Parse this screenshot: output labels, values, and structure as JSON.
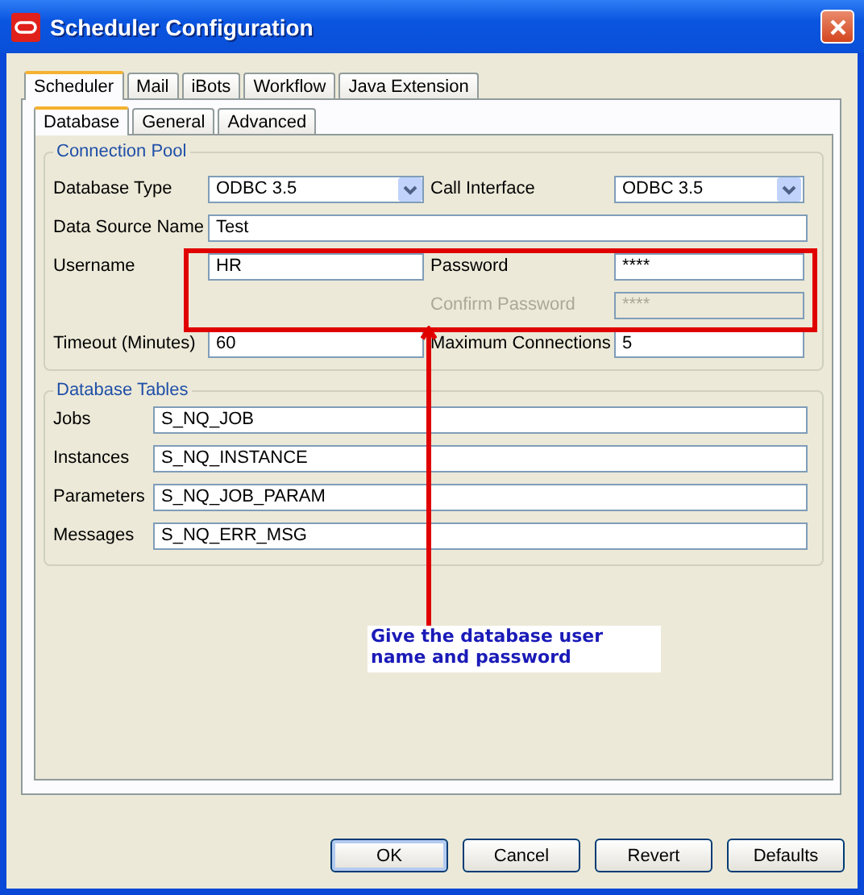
{
  "window": {
    "title": "Scheduler Configuration"
  },
  "tabs": [
    {
      "label": "Scheduler",
      "selected": true
    },
    {
      "label": "Mail",
      "selected": false
    },
    {
      "label": "iBots",
      "selected": false
    },
    {
      "label": "Workflow",
      "selected": false
    },
    {
      "label": "Java Extension",
      "selected": false
    }
  ],
  "subtabs": [
    {
      "label": "Database",
      "selected": true
    },
    {
      "label": "General",
      "selected": false
    },
    {
      "label": "Advanced",
      "selected": false
    }
  ],
  "connection_pool": {
    "title": "Connection Pool",
    "rows": [
      {
        "left": {
          "label": "Database Type",
          "value": "ODBC 3.5",
          "kind": "select",
          "disabled": false
        },
        "right": {
          "label": "Call Interface",
          "value": "ODBC 3.5",
          "kind": "select",
          "disabled": false
        }
      },
      {
        "left": {
          "label": "Data Source Name",
          "value": "Test",
          "kind": "text",
          "disabled": false
        }
      },
      {
        "left": {
          "label": "Username",
          "value": "HR",
          "kind": "text",
          "disabled": false
        },
        "right": {
          "label": "Password",
          "value": "****",
          "kind": "text",
          "disabled": false
        }
      },
      {
        "right": {
          "label": "Confirm Password",
          "value": "****",
          "kind": "text",
          "disabled": true
        }
      },
      {
        "left": {
          "label": "Timeout (Minutes)",
          "value": "60",
          "kind": "text",
          "disabled": false
        },
        "right": {
          "label": "Maximum Connections",
          "value": "5",
          "kind": "text",
          "disabled": false
        }
      }
    ]
  },
  "database_tables": {
    "title": "Database Tables",
    "fields": [
      {
        "label": "Jobs",
        "value": "S_NQ_JOB"
      },
      {
        "label": "Instances",
        "value": "S_NQ_INSTANCE"
      },
      {
        "label": "Parameters",
        "value": "S_NQ_JOB_PARAM"
      },
      {
        "label": "Messages",
        "value": "S_NQ_ERR_MSG"
      }
    ]
  },
  "annotation": {
    "callout": "Give the database user name and password"
  },
  "buttons": [
    {
      "label": "OK",
      "default": true
    },
    {
      "label": "Cancel",
      "default": false
    },
    {
      "label": "Revert",
      "default": false
    },
    {
      "label": "Defaults",
      "default": false
    }
  ]
}
